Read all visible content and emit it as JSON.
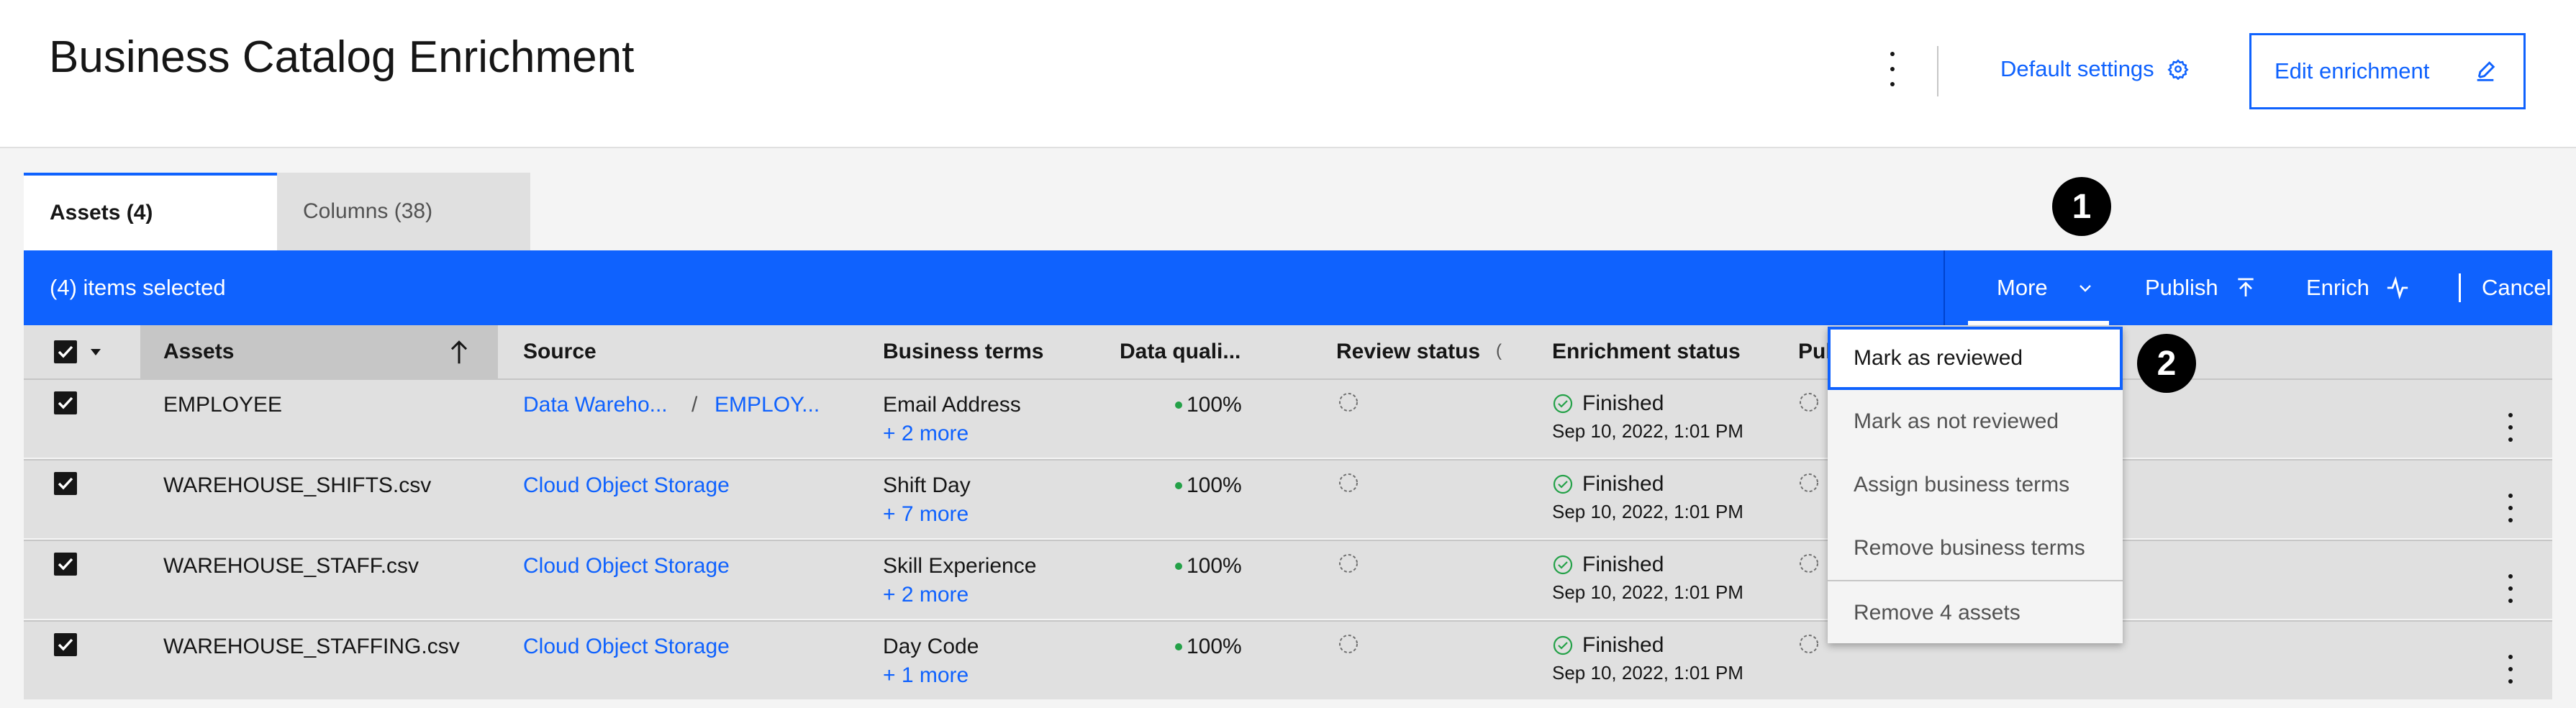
{
  "header": {
    "title": "Business Catalog Enrichment",
    "default_settings": "Default settings",
    "edit_enrichment": "Edit enrichment"
  },
  "tabs": [
    {
      "label": "Assets (4)",
      "selected": true
    },
    {
      "label": "Columns (38)",
      "selected": false
    }
  ],
  "toolbar": {
    "selected_text": "(4) items selected",
    "more": "More",
    "publish": "Publish",
    "enrich": "Enrich",
    "cancel": "Cancel"
  },
  "table": {
    "columns": [
      "Assets",
      "Source",
      "Business terms",
      "Data quali...",
      "Review status",
      "Enrichment status",
      "Pul"
    ],
    "rows": [
      {
        "asset": "EMPLOYEE",
        "source": "Data Wareho...",
        "source_sep": "/",
        "source_2": "EMPLOY...",
        "term": "Email Address",
        "more_terms": "+ 2 more",
        "quality": "100%",
        "status": "Finished",
        "date": "Sep 10, 2022, 1:01 PM"
      },
      {
        "asset": "WAREHOUSE_SHIFTS.csv",
        "source": "Cloud Object Storage",
        "term": "Shift Day",
        "more_terms": "+ 7 more",
        "quality": "100%",
        "status": "Finished",
        "date": "Sep 10, 2022, 1:01 PM"
      },
      {
        "asset": "WAREHOUSE_STAFF.csv",
        "source": "Cloud Object Storage",
        "term": "Skill Experience",
        "more_terms": "+ 2 more",
        "quality": "100%",
        "status": "Finished",
        "date": "Sep 10, 2022, 1:01 PM"
      },
      {
        "asset": "WAREHOUSE_STAFFING.csv",
        "source": "Cloud Object Storage",
        "term": "Day Code",
        "more_terms": "+ 1 more",
        "quality": "100%",
        "status": "Finished",
        "date": "Sep 10, 2022, 1:01 PM"
      }
    ]
  },
  "menu": {
    "items": [
      "Mark as reviewed",
      "Mark as not reviewed",
      "Assign business terms",
      "Remove business terms",
      "Remove 4 assets"
    ]
  },
  "callouts": [
    "1",
    "2"
  ],
  "colors": {
    "accent": "#0f62fe",
    "success": "#24a148",
    "toolbar": "#0f62fe"
  }
}
